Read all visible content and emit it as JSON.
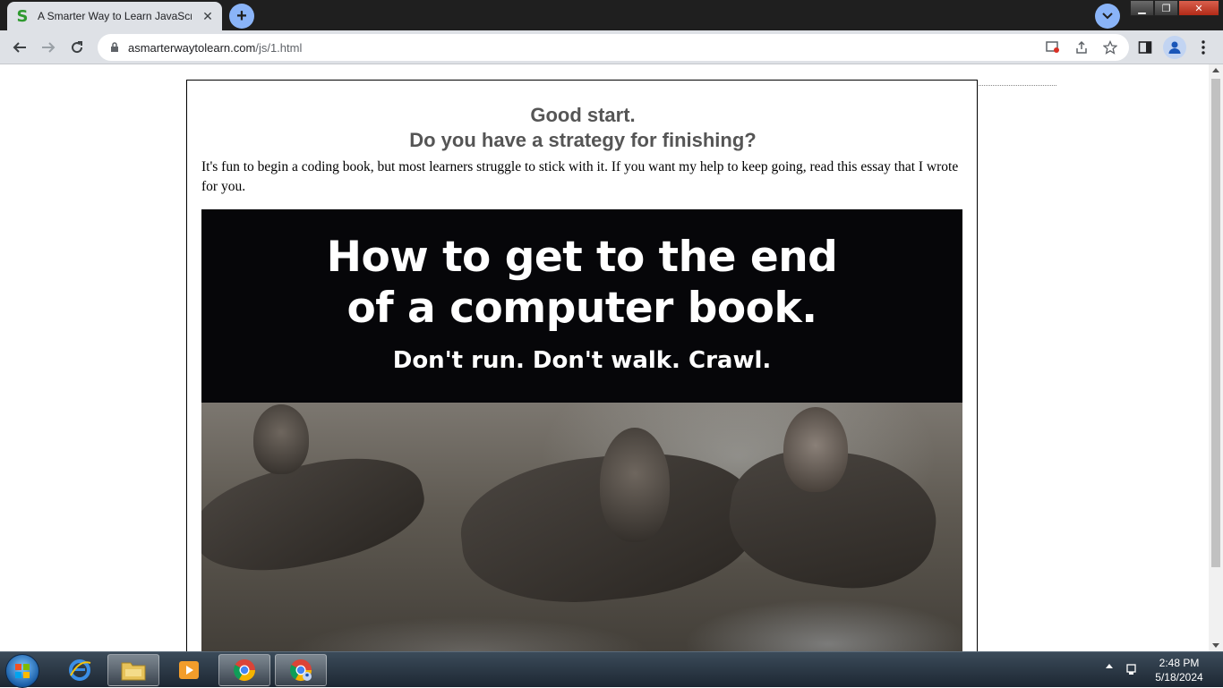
{
  "browser": {
    "tab_title": "A Smarter Way to Learn JavaScript",
    "tab_favicon_letter": "S",
    "url_domain": "asmarterwaytolearn.com",
    "url_path": "/js/1.html"
  },
  "page": {
    "heading_line1": "Good start.",
    "heading_line2": "Do you have a strategy for finishing?",
    "paragraph": "It's fun to begin a coding book, but most learners struggle to stick with it. If you want my help to keep going, read this essay that I wrote for you.",
    "banner_title_line1": "How to get to the end",
    "banner_title_line2": "of a computer book.",
    "banner_subtitle": "Don't run. Don't walk. Crawl."
  },
  "taskbar": {
    "time": "2:48 PM",
    "date": "5/18/2024",
    "items": [
      "internet-explorer",
      "file-explorer",
      "media-player",
      "chrome",
      "chrome-profile"
    ]
  },
  "colors": {
    "heading": "#555555",
    "banner_bg": "#060609",
    "accent_blue": "#8ab4f8"
  }
}
